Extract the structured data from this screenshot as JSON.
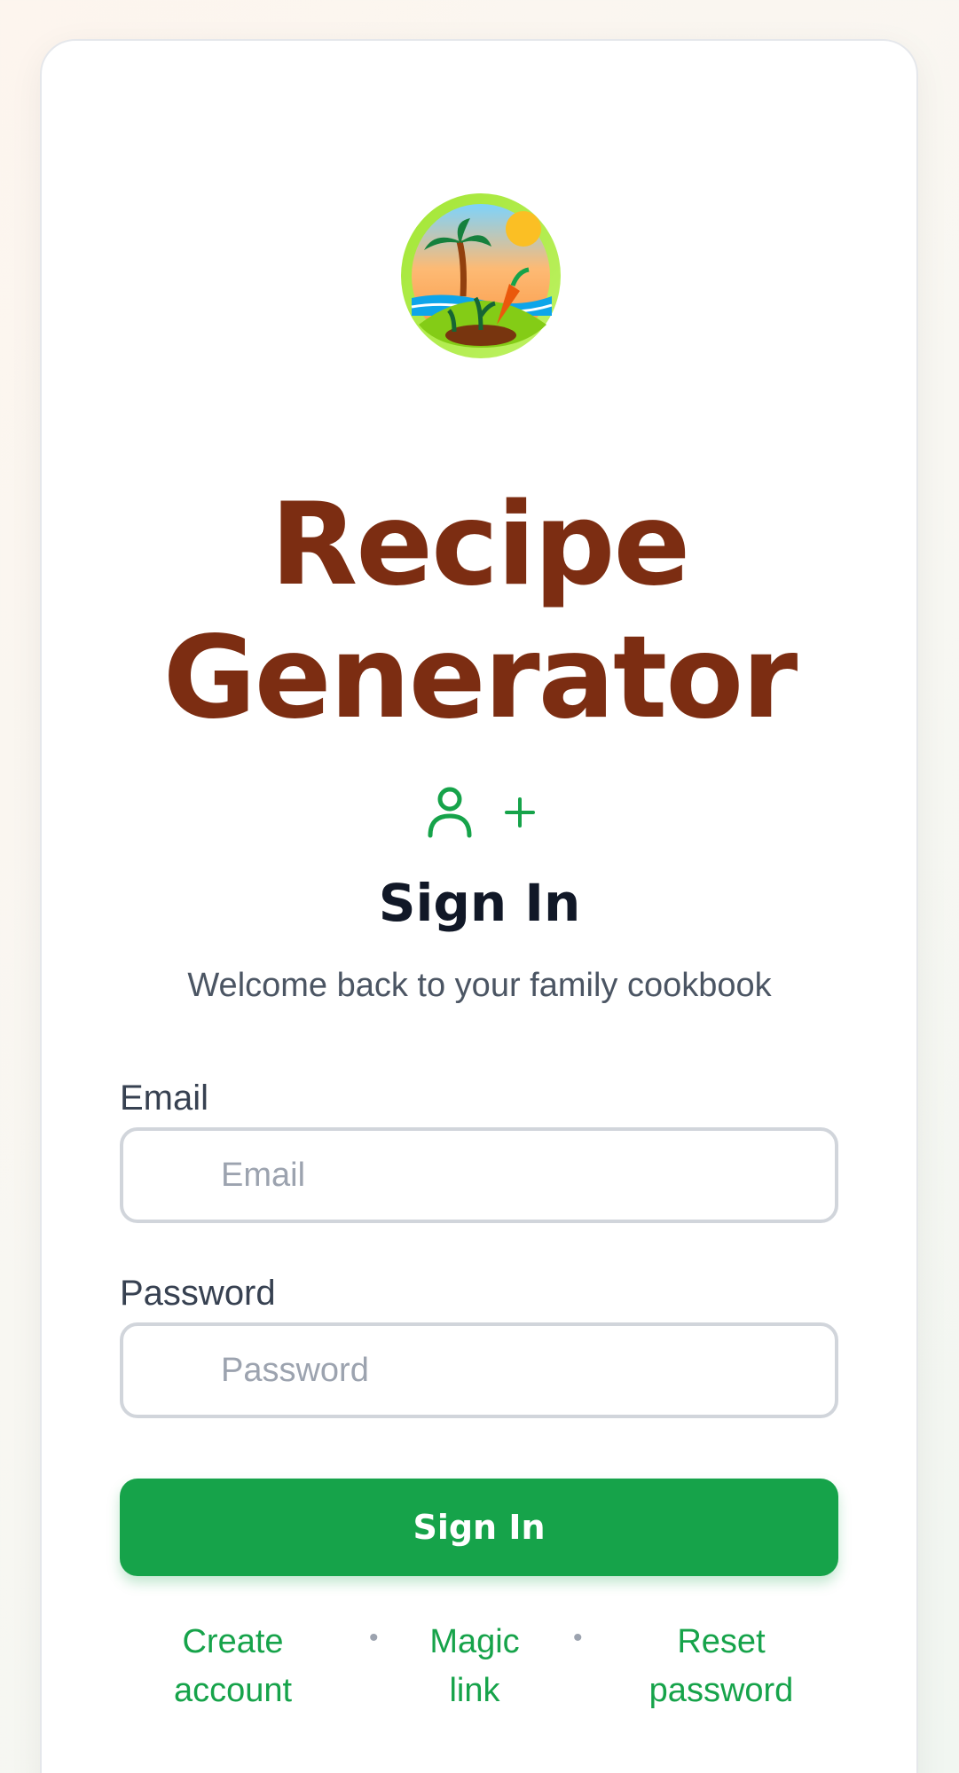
{
  "app": {
    "title": "Recipe Generator"
  },
  "logo": {
    "icon": "palm-garden-logo-icon"
  },
  "mode_icons": [
    "user-icon",
    "plus-icon"
  ],
  "form": {
    "heading": "Sign In",
    "subtitle": "Welcome back to your family cookbook",
    "email": {
      "label": "Email",
      "placeholder": "Email",
      "value": ""
    },
    "password": {
      "label": "Password",
      "placeholder": "Password",
      "value": ""
    },
    "submit_label": "Sign In"
  },
  "links": {
    "create_account": "Create account",
    "magic_link": "Magic link",
    "reset_password": "Reset password",
    "separator": "•"
  },
  "colors": {
    "title": "#7c2d12",
    "accent": "#16a34a",
    "heading": "#111827"
  }
}
